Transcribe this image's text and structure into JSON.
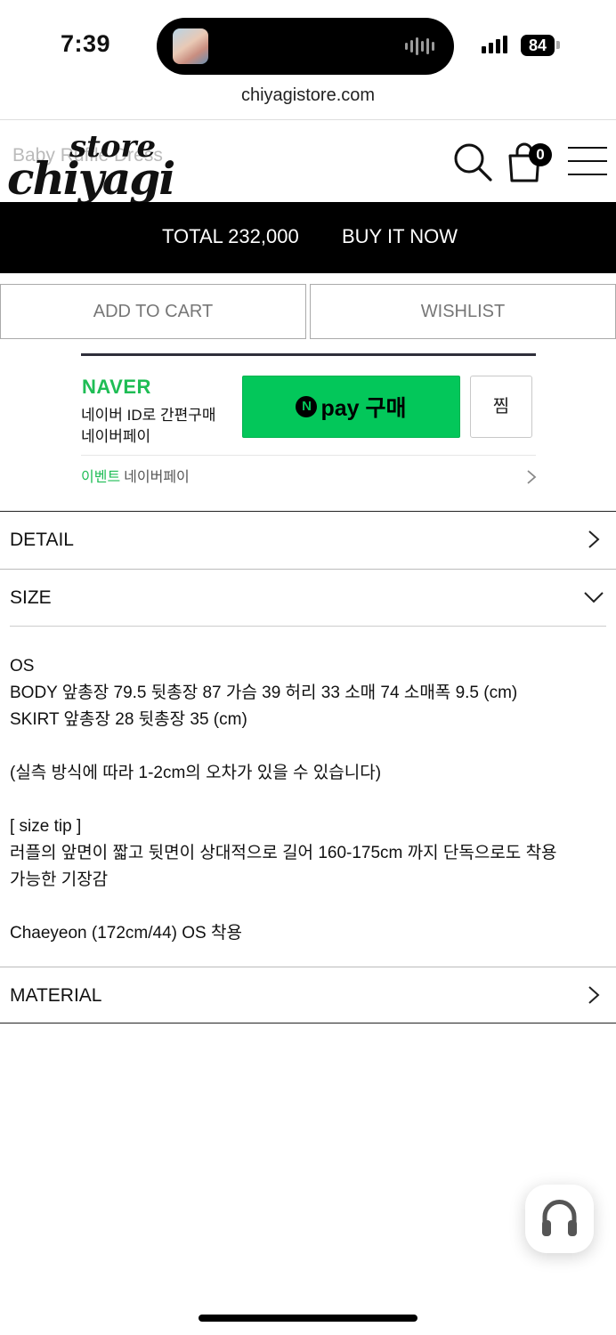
{
  "status_bar": {
    "time": "7:39",
    "battery": "84"
  },
  "browser": {
    "url": "chiyagistore.com"
  },
  "header": {
    "logo_top": "store",
    "logo_main": "chiyagi",
    "ghost_title": "Baby Ruffle Dress",
    "cart_count": "0"
  },
  "buy_bar": {
    "total": "TOTAL 232,000",
    "buy_now": "BUY IT NOW"
  },
  "actions": {
    "add_to_cart": "ADD TO CART",
    "wishlist": "WISHLIST"
  },
  "naver_pay": {
    "brand": "NAVER",
    "line1": "네이버 ID로 간편구매",
    "line2": "네이버페이",
    "n_glyph": "N",
    "pay_button": "pay 구매",
    "zzim": "찜",
    "event_tag": "이벤트",
    "event_text": "네이버페이"
  },
  "accordion": {
    "detail": "DETAIL",
    "size": "SIZE",
    "material": "MATERIAL"
  },
  "size_info": {
    "line1": "OS",
    "line2": "BODY 앞총장 79.5  뒷총장 87  가슴 39  허리 33  소매 74  소매폭 9.5 (cm)",
    "line3": "SKIRT 앞총장 28  뒷총장 35 (cm)",
    "note": "(실측 방식에 따라 1-2cm의 오차가 있을 수 있습니다)",
    "tip_title": "[ size tip ]",
    "tip_line1": "러플의 앞면이 짧고 뒷면이 상대적으로 길어 160-175cm 까지 단독으로도 착용",
    "tip_line2": "가능한 기장감",
    "model": "Chaeyeon (172cm/44) OS 착용"
  },
  "colors": {
    "naver_green": "#03c75a",
    "black_bar": "#000000"
  }
}
